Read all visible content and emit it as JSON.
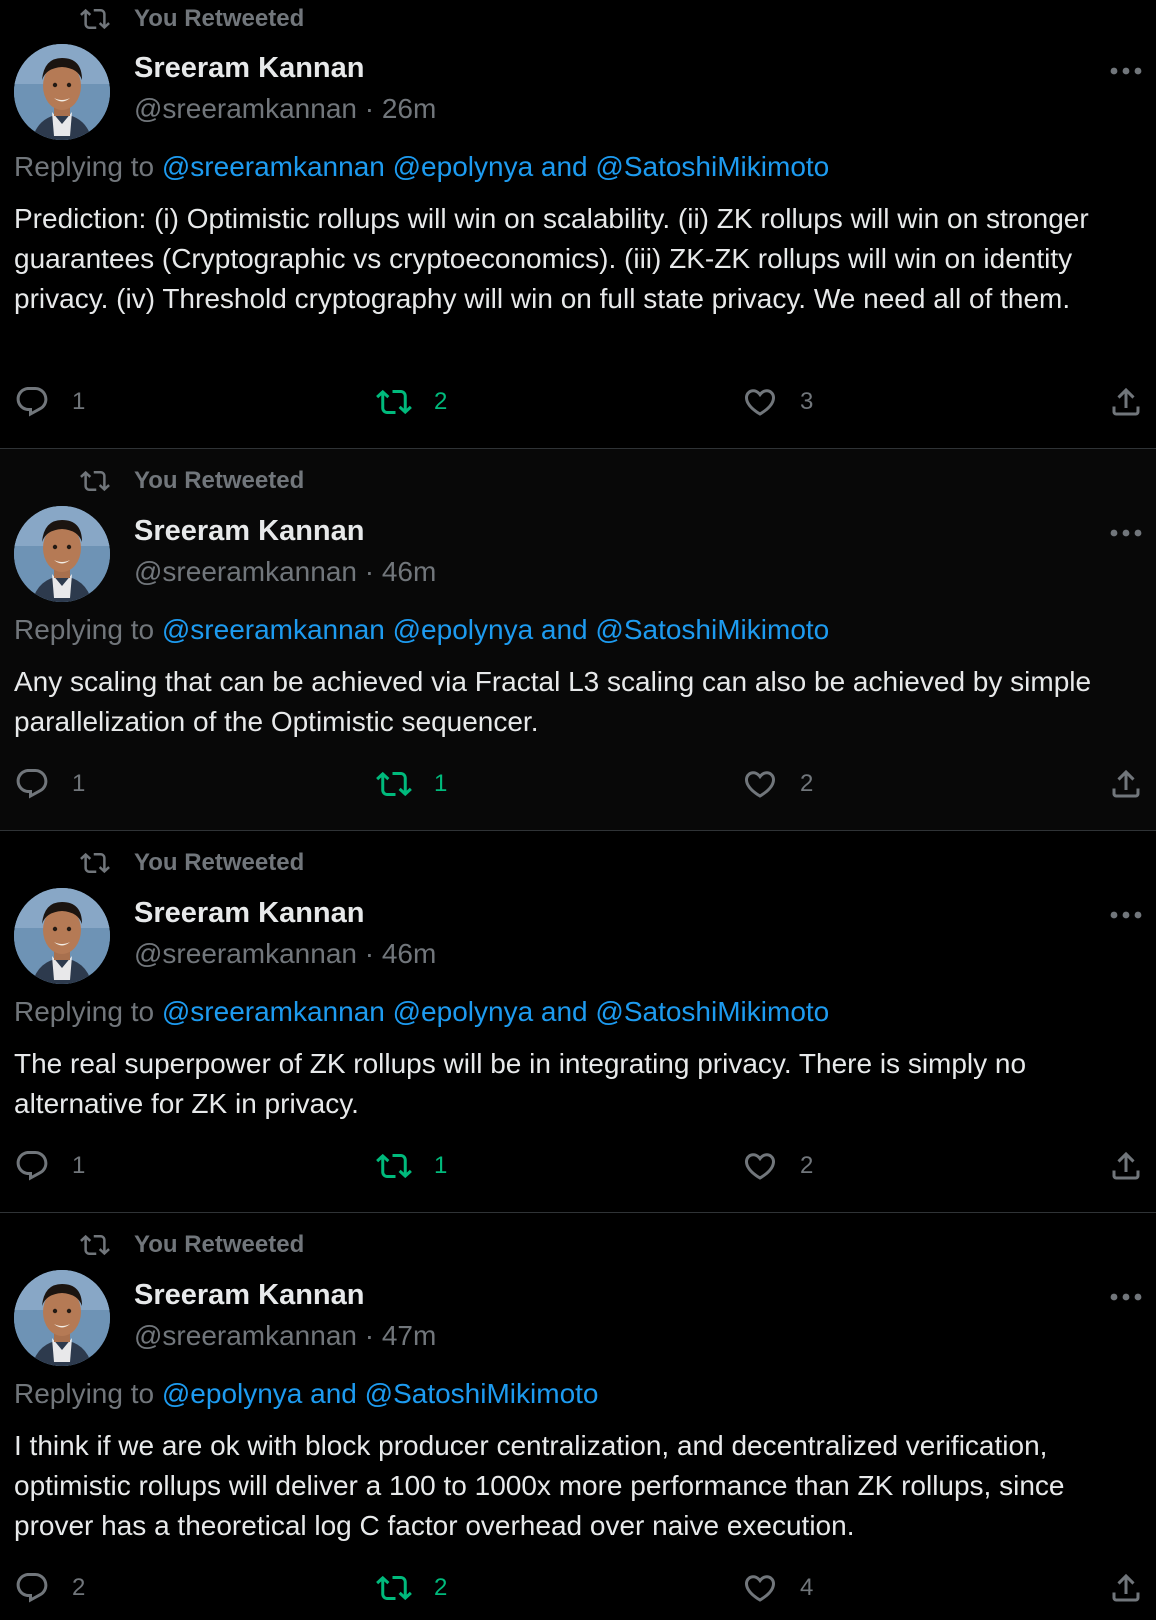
{
  "retweet_label": "You Retweeted",
  "tweets": [
    {
      "author_name": "Sreeram Kannan",
      "handle_time": "@sreeramkannan · 26m",
      "replying_prefix": "Replying to ",
      "replying_to": "@sreeramkannan @epolynya and @SatoshiMikimoto",
      "text": "Prediction: (i) Optimistic rollups will win on scalability. (ii) ZK rollups will win on stronger guarantees (Cryptographic vs cryptoeconomics). (iii) ZK-ZK rollups will win on identity privacy. (iv) Threshold cryptography will win on full state privacy. We need all of them.",
      "replies": "1",
      "retweets": "2",
      "likes": "3"
    },
    {
      "author_name": "Sreeram Kannan",
      "handle_time": "@sreeramkannan · 46m",
      "replying_prefix": "Replying to ",
      "replying_to": "@sreeramkannan @epolynya and @SatoshiMikimoto",
      "text": "Any scaling that can be achieved via Fractal L3 scaling can also be achieved by simple parallelization of the Optimistic sequencer.",
      "replies": "1",
      "retweets": "1",
      "likes": "2"
    },
    {
      "author_name": "Sreeram Kannan",
      "handle_time": "@sreeramkannan · 46m",
      "replying_prefix": "Replying to ",
      "replying_to": "@sreeramkannan @epolynya and @SatoshiMikimoto",
      "text": "The real superpower of ZK rollups will be in integrating privacy. There is simply no alternative for ZK in privacy.",
      "replies": "1",
      "retweets": "1",
      "likes": "2"
    },
    {
      "author_name": "Sreeram Kannan",
      "handle_time": "@sreeramkannan · 47m",
      "replying_prefix": "Replying to ",
      "replying_to": "@epolynya and @SatoshiMikimoto",
      "text": "I think if we are ok with block producer centralization, and decentralized verification, optimistic rollups will deliver a 100 to 1000x more performance than ZK rollups, since prover has a theoretical log C factor overhead over naive execution.",
      "replies": "2",
      "retweets": "2",
      "likes": "4"
    }
  ],
  "icons": {
    "retweet": "retweet-icon",
    "reply": "reply-icon",
    "like": "heart-icon",
    "share": "share-icon",
    "more": "more-icon"
  },
  "colors": {
    "background": "#000000",
    "text": "#e7e9ea",
    "muted": "#71767b",
    "link": "#1d9bf0",
    "retweet_active": "#00ba7c",
    "divider": "#2f3336"
  }
}
